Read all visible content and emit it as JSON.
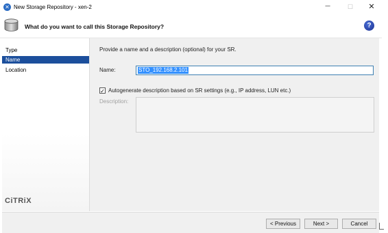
{
  "window": {
    "title": "New Storage Repository - xen-2",
    "minimize": "─",
    "maximize": "☐",
    "close": "✕"
  },
  "header": {
    "title": "What do you want to call this Storage Repository?",
    "help": "?"
  },
  "sidebar": {
    "items": [
      {
        "label": "Type",
        "active": false
      },
      {
        "label": "Name",
        "active": true
      },
      {
        "label": "Location",
        "active": false
      }
    ],
    "logo": "CiTRiX"
  },
  "content": {
    "prompt": "Provide a name and a description (optional) for your SR.",
    "name_label": "Name:",
    "name_value": "STO_192.168.2.101",
    "autogen_checked": true,
    "autogen_label": "Autogenerate description based on SR settings (e.g., IP address, LUN etc.)",
    "description_label": "Description:",
    "description_value": ""
  },
  "footer": {
    "back_label": "< Previous",
    "next_label": "Next >",
    "cancel_label": "Cancel"
  },
  "colors": {
    "accent": "#1c4f9c",
    "selection": "#3390ff",
    "help": "#1b2f8f"
  },
  "icons": {
    "app": "xencenter-icon",
    "header": "storage-icon",
    "help": "help-icon"
  }
}
